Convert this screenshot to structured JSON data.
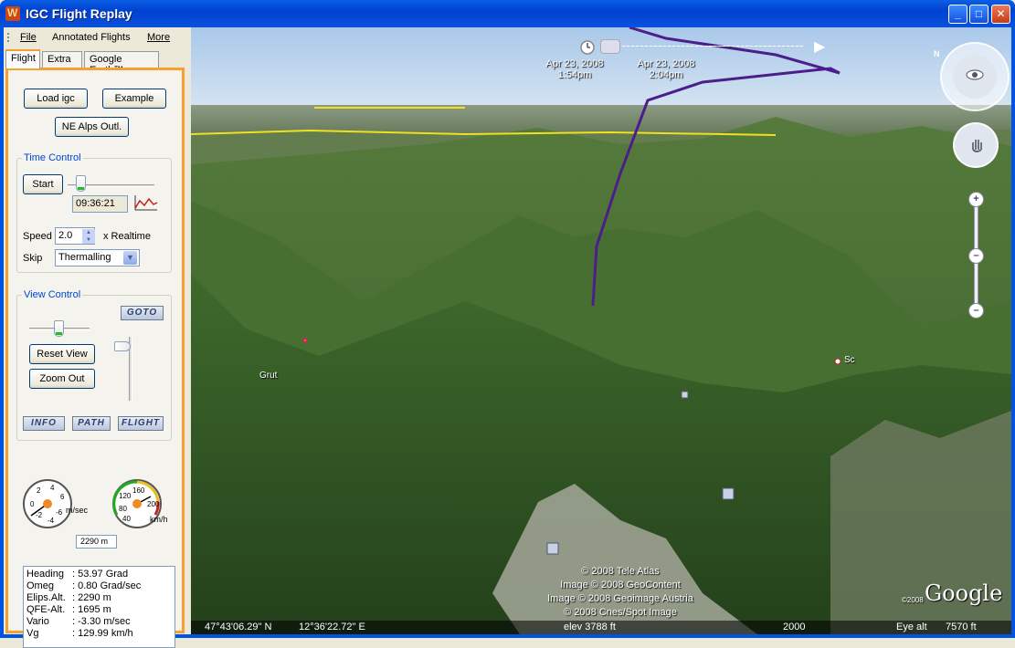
{
  "window": {
    "title": "IGC Flight Replay",
    "min": "_",
    "max": "□",
    "close": "✕"
  },
  "menu": {
    "file": "File",
    "annotated": "Annotated Flights",
    "more": "More"
  },
  "tabs": {
    "flight": "Flight",
    "extra": "Extra",
    "google": "Google Earth™"
  },
  "buttons": {
    "load": "Load igc",
    "example": "Example",
    "ne_alps": "NE Alps Outl.",
    "start": "Start",
    "reset_view": "Reset View",
    "zoom_out": "Zoom Out",
    "goto": "GOTO",
    "info": "INFO",
    "path": "PATH",
    "flight": "FLIGHT"
  },
  "time_control": {
    "title": "Time Control",
    "time": "09:36:21",
    "speed_label": "Speed",
    "speed": "2.0",
    "realtime": "x Realtime",
    "skip_label": "Skip",
    "skip": "Thermalling"
  },
  "view_control": {
    "title": "View Control"
  },
  "vario_gauge": {
    "unit": "m/sec",
    "ticks": [
      "0",
      "2",
      "4",
      "6",
      "-2",
      "-4",
      "-6"
    ]
  },
  "speed_gauge": {
    "unit": "km/h",
    "ticks": [
      "40",
      "80",
      "120",
      "160",
      "200"
    ]
  },
  "altitude_readout": "2290 m",
  "info": [
    {
      "k": "Heading",
      "v": ": 53.97 Grad"
    },
    {
      "k": "Omeg",
      "v": ": 0.80 Grad/sec"
    },
    {
      "k": "Elips.Alt.",
      "v": ": 2290 m"
    },
    {
      "k": "QFE-Alt.",
      "v": ": 1695 m"
    },
    {
      "k": "Vario",
      "v": ": -3.30 m/sec"
    },
    {
      "k": "Vg",
      "v": ": 129.99 km/h"
    }
  ],
  "map": {
    "time_start_date": "Apr 23, 2008",
    "time_start_time": "1:54pm",
    "time_end_date": "Apr 23, 2008",
    "time_end_time": "2:04pm",
    "credits": [
      "© 2008 Tele Atlas",
      "Image © 2008 GeoContent",
      "Image © 2008 Geoimage Austria",
      "© 2008 Cnes/Spot Image"
    ],
    "copyright_year": "©2008",
    "logo": "Google",
    "place_grue": "Grut",
    "place_sc": "Sc",
    "lat": "47°43'06.29\" N",
    "lon": "12°36'22.72\" E",
    "elev": "elev  3788 ft",
    "scale": "2000",
    "eye_label": "Eye alt",
    "eye_value": "7570 ft"
  },
  "colors": {
    "track": "#4b1e8c",
    "border": "#2a2aff",
    "accent": "#f5a030"
  }
}
